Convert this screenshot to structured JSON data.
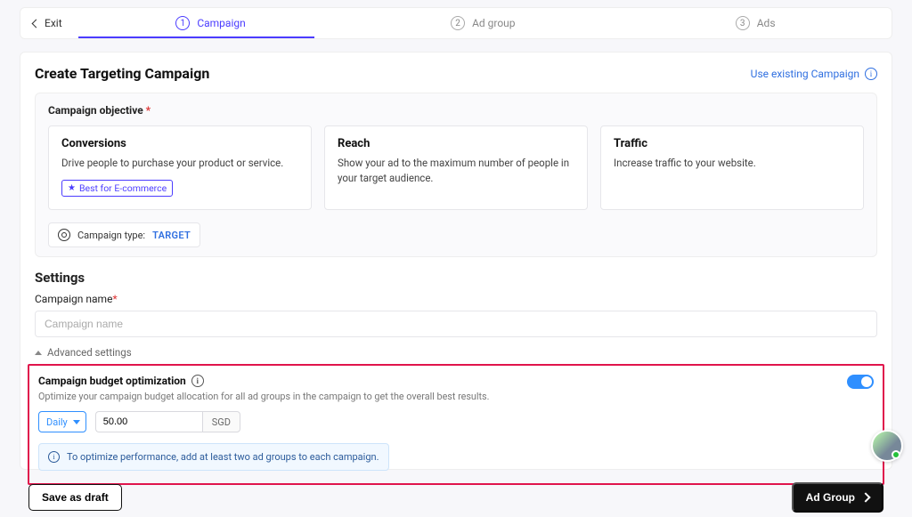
{
  "topbar": {
    "exit": "Exit",
    "steps": [
      {
        "num": "1",
        "label": "Campaign"
      },
      {
        "num": "2",
        "label": "Ad group"
      },
      {
        "num": "3",
        "label": "Ads"
      }
    ]
  },
  "page": {
    "title": "Create Targeting Campaign",
    "use_existing": "Use existing Campaign"
  },
  "objective": {
    "section_label": "Campaign objective",
    "required_mark": "*",
    "cards": [
      {
        "title": "Conversions",
        "desc": "Drive people to purchase your product or service.",
        "badge": "Best for E-commerce"
      },
      {
        "title": "Reach",
        "desc": "Show your ad to the maximum number of people in your target audience."
      },
      {
        "title": "Traffic",
        "desc": "Increase traffic to your website."
      }
    ],
    "campaign_type_label": "Campaign type:",
    "campaign_type_value": "TARGET"
  },
  "settings": {
    "heading": "Settings",
    "name_label": "Campaign name",
    "name_required_mark": "*",
    "name_placeholder": "Campaign name",
    "name_value": "",
    "advanced_label": "Advanced settings"
  },
  "cbo": {
    "title": "Campaign budget optimization",
    "desc": "Optimize your campaign budget allocation for all ad groups in the campaign to get the overall best results.",
    "enabled": true,
    "period_select": "Daily",
    "amount_value": "50.00",
    "currency": "SGD",
    "tip": "To optimize performance, add at least two ad groups to each campaign."
  },
  "footer": {
    "save_draft": "Save as draft",
    "next": "Ad Group"
  }
}
